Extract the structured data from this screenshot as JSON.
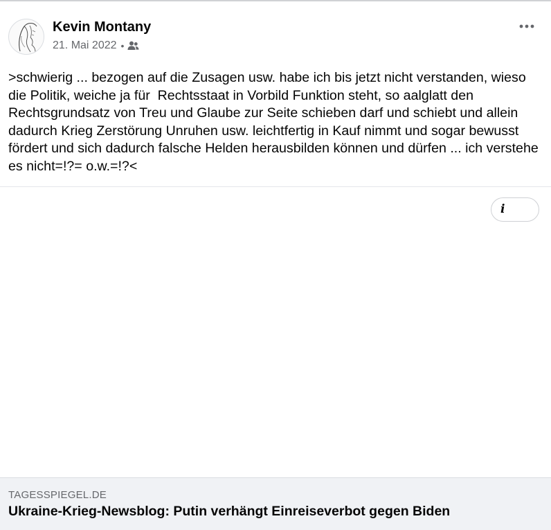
{
  "post": {
    "author": "Kevin Montany",
    "date": "21. Mai 2022",
    "separator": "•",
    "audience_icon": "friends-icon",
    "text": ">schwierig ... bezogen auf die Zusagen usw. habe ich bis jetzt nicht verstanden, wieso die Politik, weiche ja für  Rechtsstaat in Vorbild Funktion steht, so aalglatt den Rechtsgrundsatz von Treu und Glaube zur Seite schieben darf und schiebt und allein dadurch Krieg Zerstörung Unruhen usw. leichtfertig in Kauf nimmt und sogar bewusst fördert und sich dadurch falsche Helden herausbilden können und dürfen ... ich verstehe es nicht=!?= o.w.=!?<"
  },
  "info_button": {
    "glyph": "i"
  },
  "link_preview": {
    "domain": "TAGESSPIEGEL.DE",
    "title": "Ukraine-Krieg-Newsblog: Putin verhängt Einreiseverbot gegen Biden"
  },
  "colors": {
    "text_primary": "#050505",
    "text_secondary": "#65676b",
    "card_background": "#f0f2f5",
    "divider": "#e4e6eb"
  }
}
